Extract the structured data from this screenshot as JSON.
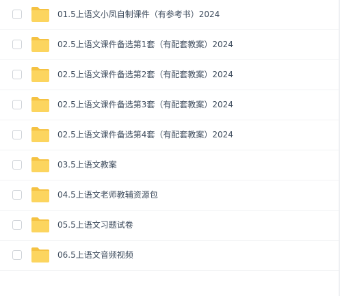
{
  "files": [
    {
      "name": "01.5上语文小凤自制课件（有参考书）2024",
      "type": "folder"
    },
    {
      "name": "02.5上语文课件备选第1套（有配套教案）2024",
      "type": "folder"
    },
    {
      "name": "02.5上语文课件备选第2套（有配套教案）2024",
      "type": "folder"
    },
    {
      "name": "02.5上语文课件备选第3套（有配套教案）2024",
      "type": "folder"
    },
    {
      "name": "02.5上语文课件备选第4套（有配套教案）2024",
      "type": "folder"
    },
    {
      "name": "03.5上语文教案",
      "type": "folder"
    },
    {
      "name": "04.5上语文老师教辅资源包",
      "type": "folder"
    },
    {
      "name": "05.5上语文习题试卷",
      "type": "folder"
    },
    {
      "name": "06.5上语文音频视频",
      "type": "folder"
    }
  ],
  "colors": {
    "folder_front": "#fcd55f",
    "folder_back": "#f5c242",
    "text": "#3d4b5c",
    "checkbox_border": "#cfd3d8",
    "divider": "#f1f2f4"
  },
  "icons": {
    "folder": "folder-icon"
  }
}
